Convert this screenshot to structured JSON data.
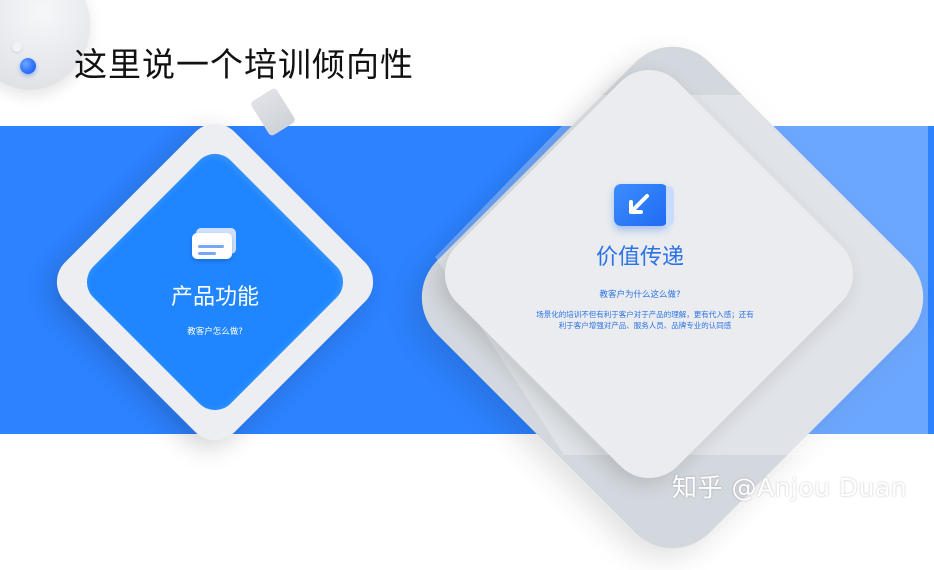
{
  "slide": {
    "title": "这里说一个培训倾向性"
  },
  "left_card": {
    "icon": "card-icon",
    "heading": "产品功能",
    "subtitle": "教客户怎么做?"
  },
  "right_card": {
    "icon": "arrow-down-left-icon",
    "heading": "价值传递",
    "subtitle": "教客户为什么这么做?",
    "description_line1": "场景化的培训不但有利于客户对于产品的理解，更有代入感；还有",
    "description_line2": "利于客户增强对产品、服务人员、品牌专业的认同感"
  },
  "watermark": {
    "text": "知乎 @Anjou Duan"
  },
  "colors": {
    "accent_blue": "#2d82ff",
    "text_blue": "#2a72e6",
    "title_text": "#111111"
  }
}
